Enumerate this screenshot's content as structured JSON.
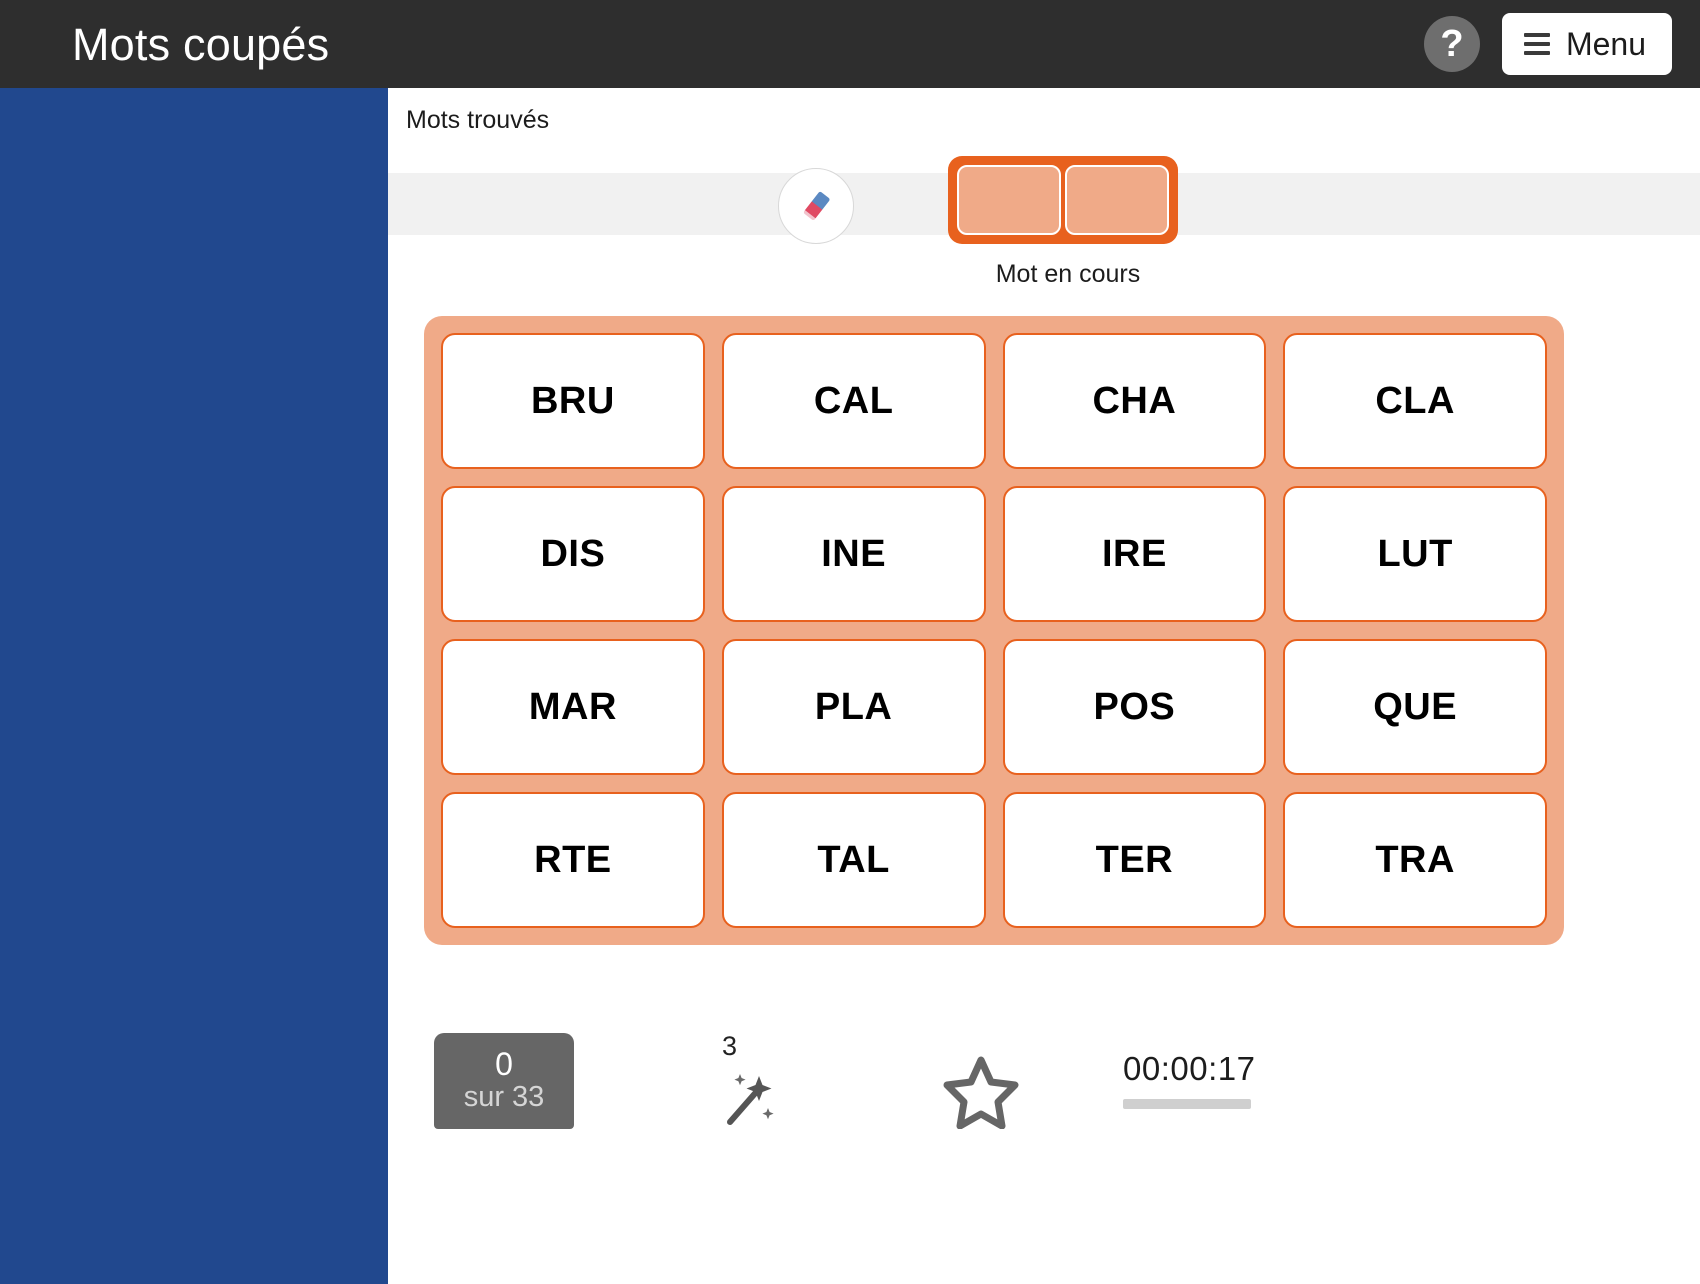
{
  "header": {
    "title": "Mots coupés",
    "help_icon": "question-mark-icon",
    "help_label": "?",
    "menu_label": "Menu",
    "background_color": "#2e2e2e"
  },
  "sidebar": {
    "background_color": "#21488e"
  },
  "main": {
    "found_words_label": "Mots trouvés",
    "eraser_icon": "eraser-icon",
    "current_word": {
      "label": "Mot en cours",
      "slots": [
        "",
        ""
      ],
      "border_color": "#e8611e",
      "slot_color": "#f0aa88"
    },
    "tiles": [
      "BRU",
      "CAL",
      "CHA",
      "CLA",
      "DIS",
      "INE",
      "IRE",
      "LUT",
      "MAR",
      "PLA",
      "POS",
      "QUE",
      "RTE",
      "TAL",
      "TER",
      "TRA"
    ],
    "tile_panel_color": "#f0aa88",
    "tile_border_color": "#e8611e"
  },
  "status": {
    "score_current": "0",
    "score_total": "sur 33",
    "hint_count": "3",
    "hint_icon": "magic-wand-icon",
    "star_icon": "star-icon",
    "timer": "00:00:17"
  }
}
